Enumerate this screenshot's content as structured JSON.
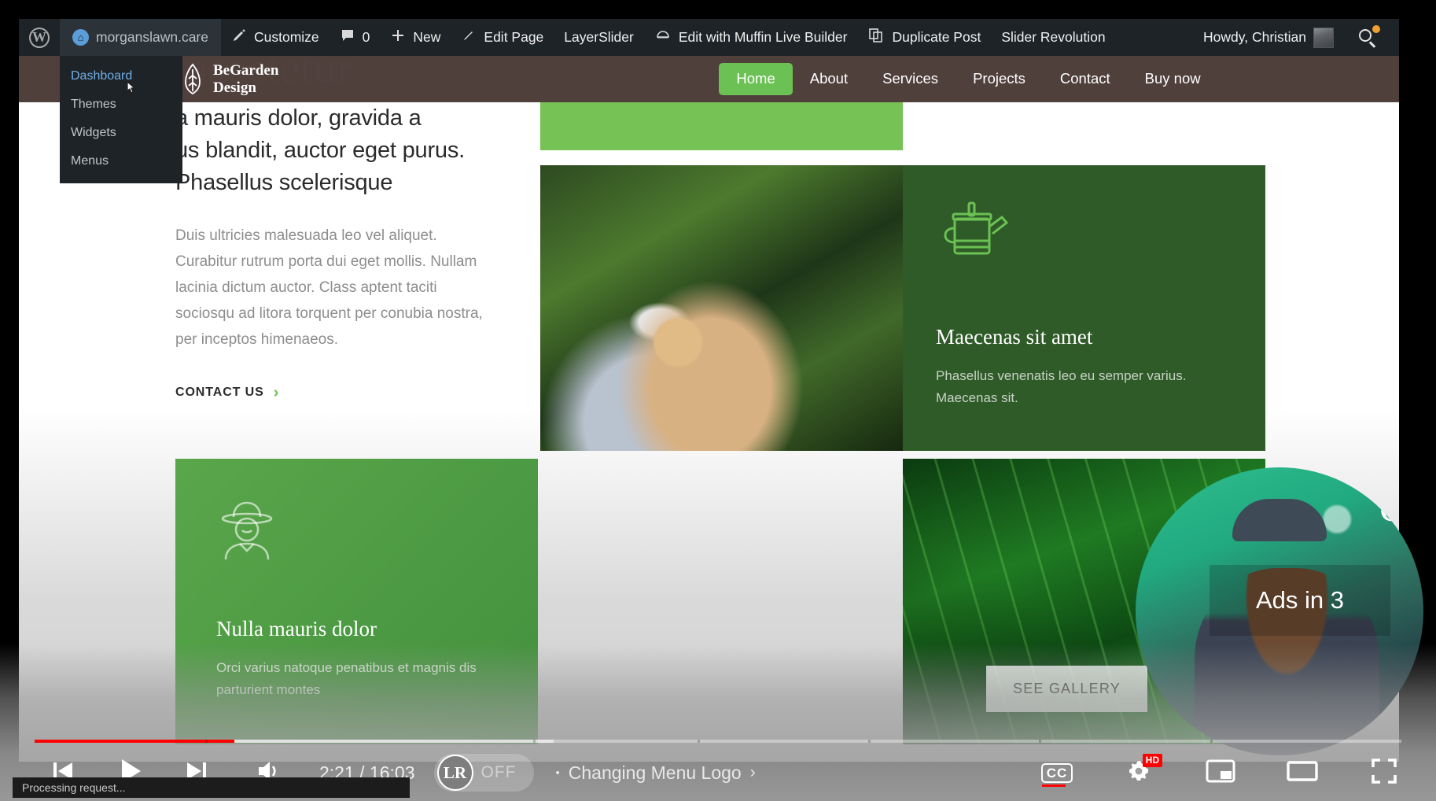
{
  "adminbar": {
    "wp_logo_icon": "wordpress-logo-icon",
    "site_name": "morganslawn.care",
    "site_icon": "dashboard-icon",
    "items": [
      {
        "label": "Customize",
        "icon": "paintbrush-icon"
      },
      {
        "label": "0",
        "icon": "comment-bubble-icon"
      },
      {
        "label": "New",
        "icon": "plus-icon"
      },
      {
        "label": "Edit Page",
        "icon": "pencil-icon"
      },
      {
        "label": "LayerSlider",
        "icon": ""
      },
      {
        "label": "Edit with Muffin Live Builder",
        "icon": "muffin-icon"
      },
      {
        "label": "Duplicate Post",
        "icon": "copy-icon"
      },
      {
        "label": "Slider Revolution",
        "icon": ""
      }
    ],
    "howdy": "Howdy, Christian",
    "avatar_icon": "avatar",
    "search_icon": "search-icon"
  },
  "dropdown": {
    "items": [
      {
        "label": "Dashboard",
        "active": true
      },
      {
        "label": "Themes",
        "active": false
      },
      {
        "label": "Widgets",
        "active": false
      },
      {
        "label": "Menus",
        "active": false
      }
    ]
  },
  "site": {
    "hero_ghost_text": "nsectetur",
    "logo_icon": "leaf-icon",
    "logo_line1": "BeGarden",
    "logo_line2": "Design",
    "nav": [
      {
        "label": "Home",
        "active": true
      },
      {
        "label": "About",
        "active": false
      },
      {
        "label": "Services",
        "active": false
      },
      {
        "label": "Projects",
        "active": false
      },
      {
        "label": "Contact",
        "active": false
      },
      {
        "label": "Buy now",
        "active": false
      }
    ],
    "accent_green": "#6bc153"
  },
  "content": {
    "heading_line1": "a mauris dolor, gravida a",
    "heading_line2": "us blandit, auctor eget purus.",
    "heading_line3": "Phasellus scelerisque",
    "body": "Duis ultricies malesuada leo vel aliquet. Curabitur rutrum porta dui eget mollis. Nullam lacinia dictum auctor. Class aptent taciti sociosqu ad litora torquent per conubia nostra, per inceptos himenaeos.",
    "cta_label": "CONTACT US",
    "cta_icon": "chevron-right-icon",
    "card_dark": {
      "icon": "watering-can-icon",
      "title": "Maecenas sit amet",
      "text": "Phasellus venenatis leo eu semper varius. Maecenas sit.",
      "bg": "#2f5b28"
    },
    "card_light": {
      "icon": "gardener-icon",
      "title": "Nulla mauris dolor",
      "text": "Orci varius natoque penatibus et magnis dis parturient montes",
      "bg": "#4c9a43"
    },
    "gallery_button": "SEE GALLERY",
    "photo1_alt": "woman-in-straw-hat-pruning-plant",
    "photo2_alt": "green-leaf-closeup"
  },
  "player": {
    "prev_icon": "previous-track-icon",
    "play_icon": "play-icon",
    "next_icon": "next-track-icon",
    "volume_icon": "volume-icon",
    "time_current": "2:21",
    "time_total": "16:03",
    "time_display": "2:21 / 16:03",
    "lr_badge_label": "OFF",
    "lr_badge_icon": "lr-logo-icon",
    "lr_badge_text": "LR",
    "chapter_bullet": "•",
    "chapter_title": "Changing Menu Logo",
    "chapter_chevron": "›",
    "captions_label": "CC",
    "captions_icon": "closed-captions-icon",
    "settings_icon": "gear-icon",
    "quality_badge": "HD",
    "miniplayer_icon": "miniplayer-icon",
    "theater_icon": "theater-mode-icon",
    "fullscreen_icon": "fullscreen-icon",
    "progress": {
      "played_percent": 14.6,
      "buffered_percent": 38.0,
      "played_color": "#ff0000",
      "chapter_marks_percent": [
        12.5,
        36.5,
        48.5,
        61.0,
        73.5,
        86.0
      ]
    },
    "ads_overlay": "Ads in 3",
    "webcam_neon_text": "C",
    "webcam_alt": "presenter-webcam"
  },
  "status": {
    "message": "Processing request..."
  }
}
